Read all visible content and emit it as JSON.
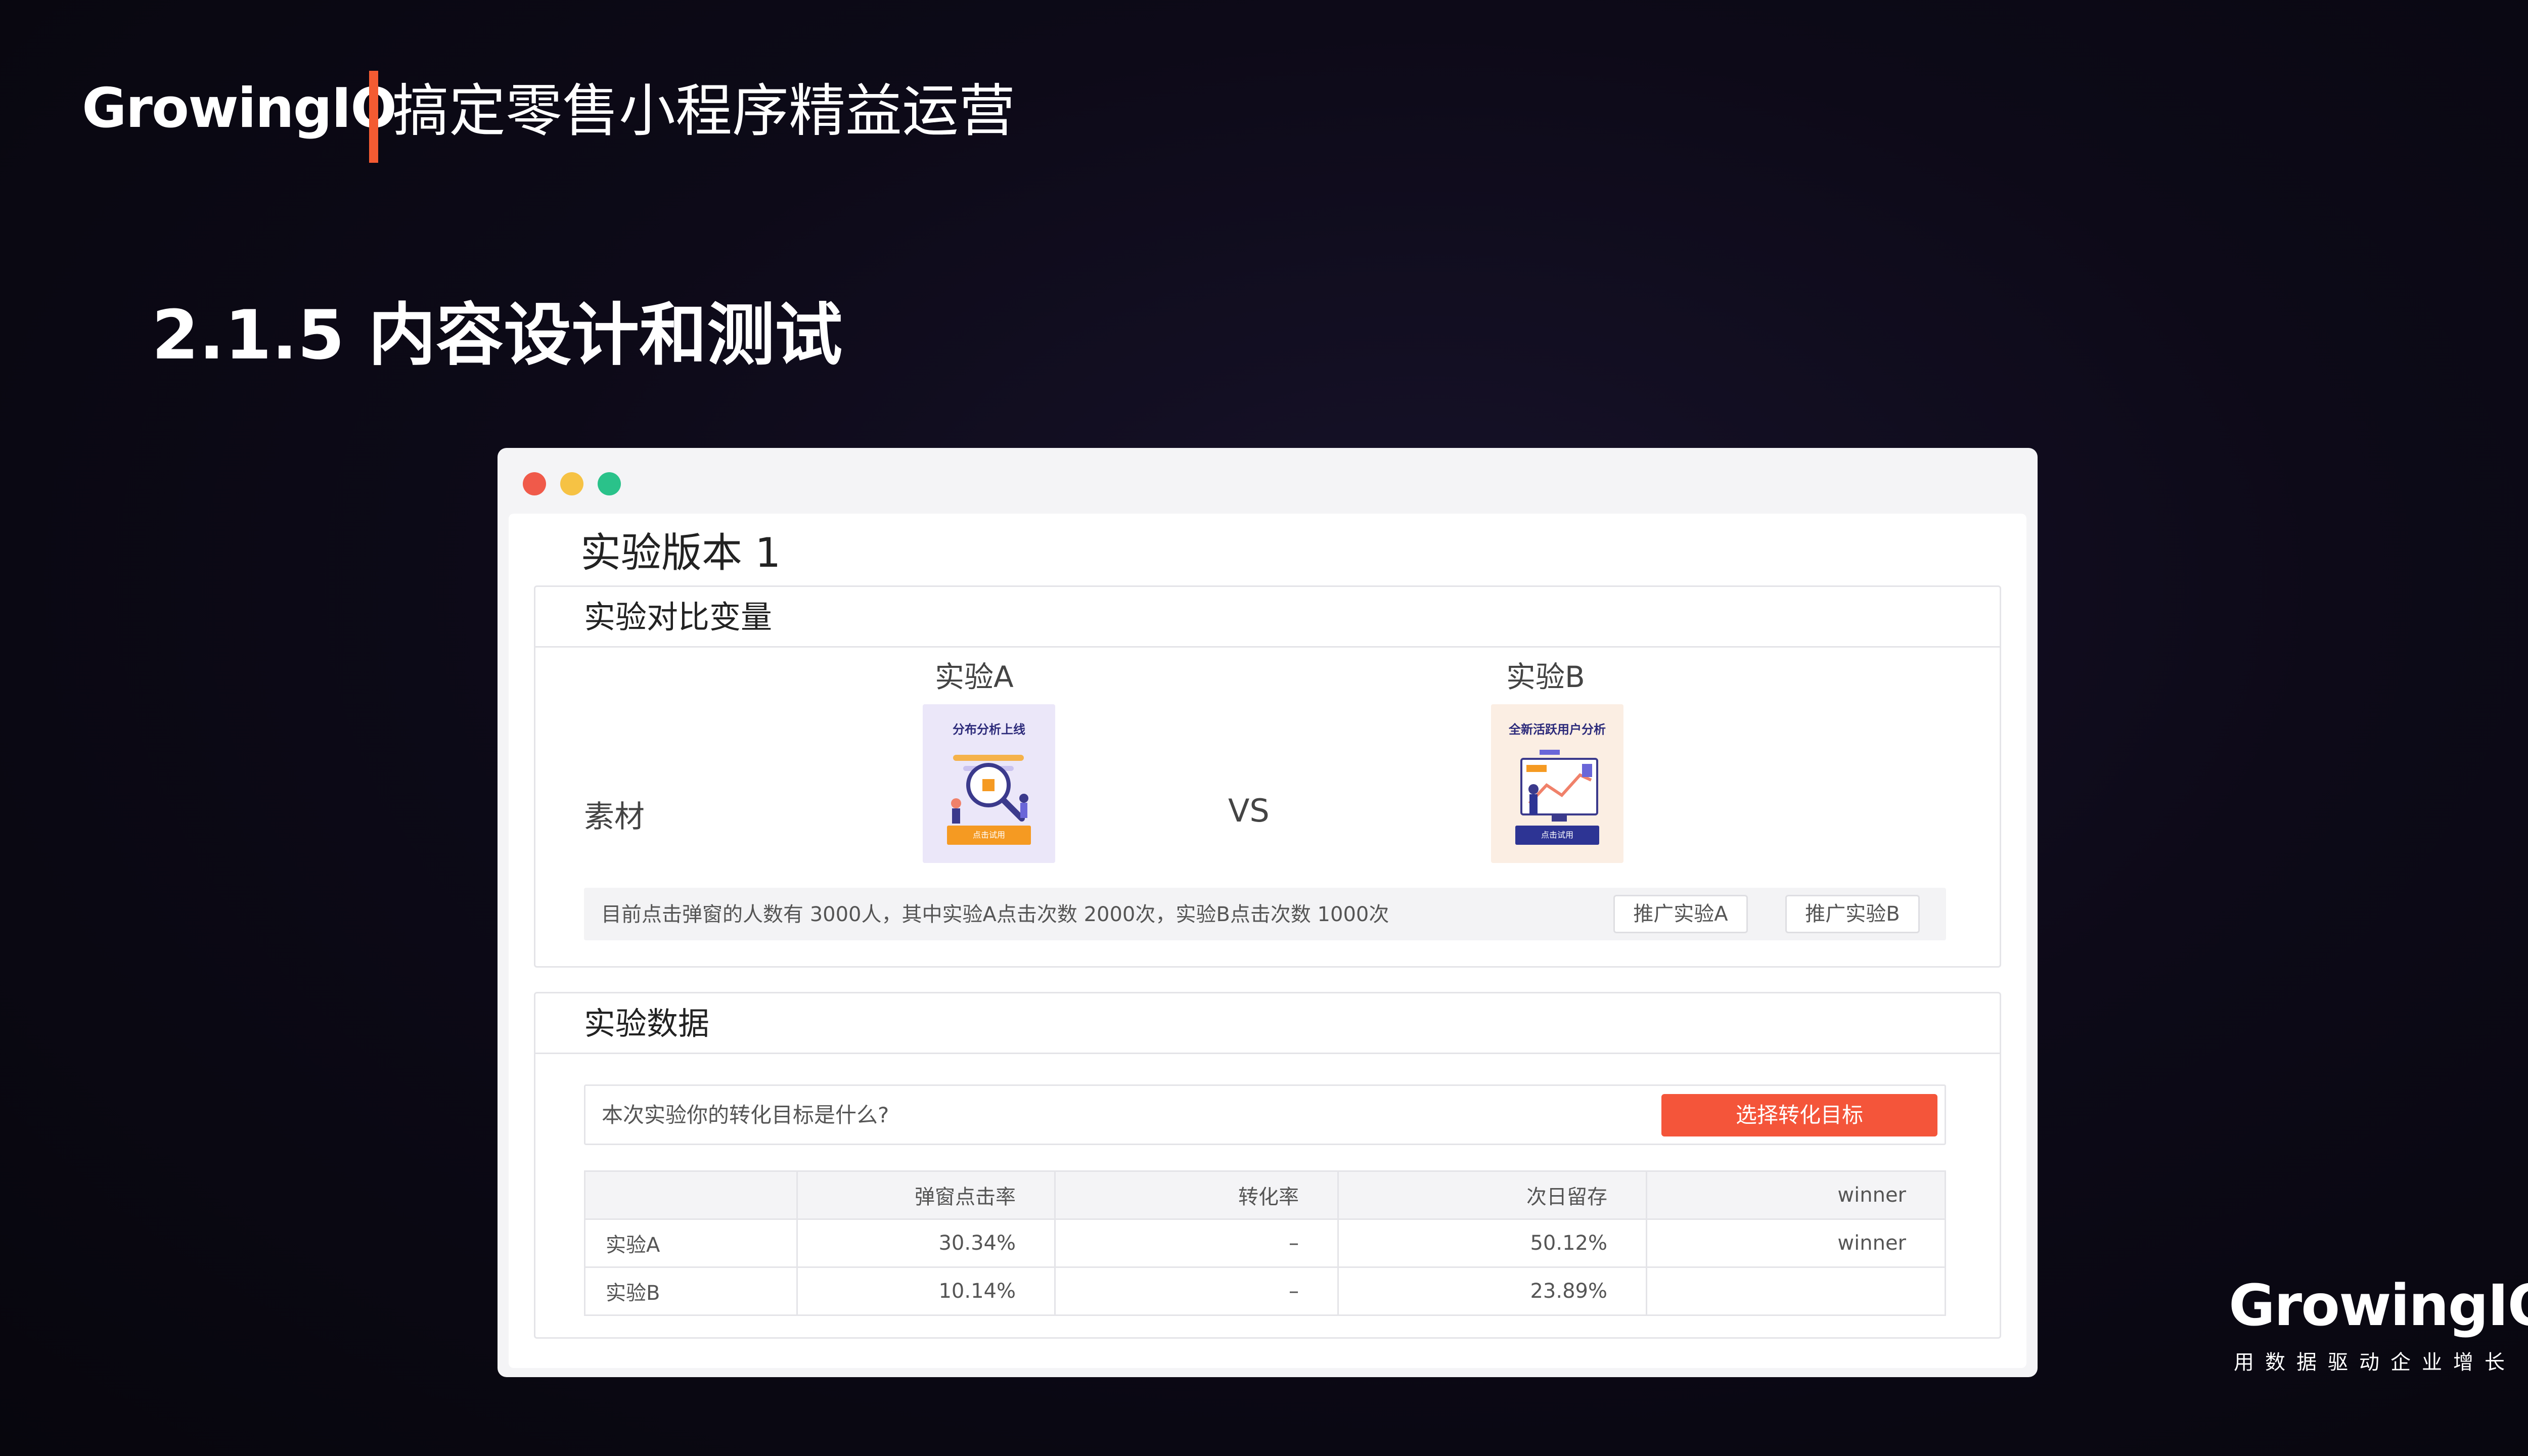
{
  "header": {
    "logo_text": "GrowingIO",
    "title": "搞定零售小程序精益运营"
  },
  "section": {
    "title": "2.1.5 内容设计和测试"
  },
  "window": {
    "controls": {
      "close": "#f05a4a",
      "minimize": "#f6c244",
      "maximize": "#2ac28a"
    },
    "title": "实验版本 1",
    "variables_panel": {
      "heading": "实验对比变量",
      "material_label": "素材",
      "experiment_a": {
        "label": "实验A",
        "thumb_title": "分布分析上线",
        "thumb_button": "点击试用"
      },
      "vs_label": "VS",
      "experiment_b": {
        "label": "实验B",
        "thumb_title": "全新活跃用户分析",
        "thumb_button": "点击试用"
      },
      "summary": "目前点击弹窗的人数有 3000人，其中实验A点击次数 2000次，实验B点击次数 1000次",
      "promote_a": "推广实验A",
      "promote_b": "推广实验B"
    },
    "data_panel": {
      "heading": "实验数据",
      "goal_prompt": "本次实验你的转化目标是什么?",
      "goal_button": "选择转化目标",
      "table": {
        "columns": [
          "",
          "弹窗点击率",
          "转化率",
          "次日留存",
          "winner"
        ],
        "rows": [
          [
            "实验A",
            "30.34%",
            "–",
            "50.12%",
            "winner"
          ],
          [
            "实验B",
            "10.14%",
            "–",
            "23.89%",
            ""
          ]
        ]
      }
    }
  },
  "footer": {
    "logo_text": "GrowingIO",
    "tagline": "用数据驱动企业增长"
  },
  "colors": {
    "accent": "#f4553a",
    "background": "#0d0a18"
  }
}
